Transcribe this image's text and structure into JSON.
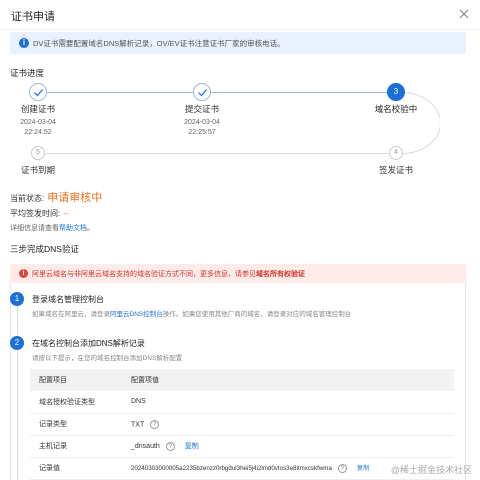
{
  "dialog": {
    "title": "证书申请"
  },
  "notice": {
    "text": "DV证书需要配置域名DNS解析记录，OV/EV证书注意证书厂家的审核电话。"
  },
  "progress": {
    "title": "证书进度",
    "steps": [
      {
        "label": "创建证书",
        "date": "2024-03-04",
        "time": "22:24:52",
        "state": "done"
      },
      {
        "label": "提交证书",
        "date": "2024-03-04",
        "time": "22:25:57",
        "state": "done"
      },
      {
        "label": "域名校验中",
        "number": "3",
        "state": "active"
      },
      {
        "label": "签发证书",
        "number": "4",
        "state": "pending"
      },
      {
        "label": "证书到期",
        "number": "5",
        "state": "pending"
      }
    ]
  },
  "status": {
    "current_label": "当前状态:",
    "current_value": "申请审核中",
    "avg_label": "平均签发时间:",
    "avg_value": "--",
    "detail_prefix": "详细信息请查看",
    "detail_link": "帮助文档",
    "detail_suffix": "。"
  },
  "dns_verify": {
    "title": "三步完成DNS验证",
    "warning_text": "阿里云域名与非阿里云域名支持的域名验证方式不同，更多信息，请参见",
    "warning_link": "域名所有权验证",
    "step1": {
      "number": "1",
      "title": "登录域名管理控制台",
      "desc_a": "如果域名在阿里云，请登录",
      "desc_link": "阿里云DNS控制台",
      "desc_b": "操作。如果您使用其他厂商的域名，请登录对应的域名管理控制台"
    },
    "step2": {
      "number": "2",
      "title": "在域名控制台添加DNS解析记录",
      "desc": "请按以下提示，在您的域名控制台添加DNS解析配置"
    },
    "table": {
      "headers": [
        "配置项目",
        "配置项值"
      ],
      "rows": [
        {
          "item": "域名授权验证类型",
          "value": "DNS"
        },
        {
          "item": "记录类型",
          "value": "TXT",
          "help": "?"
        },
        {
          "item": "主机记录",
          "value": "_dnsauth",
          "help": "?",
          "copy": "复制"
        },
        {
          "item": "记录值",
          "value": "20240303000005a2235bzenzz0rbgdul3hei5j4i2lmd0vtos3e8itmxcskfwma",
          "help": "?",
          "copy": "复制"
        }
      ]
    }
  },
  "watermark": "@稀土掘金技术社区"
}
